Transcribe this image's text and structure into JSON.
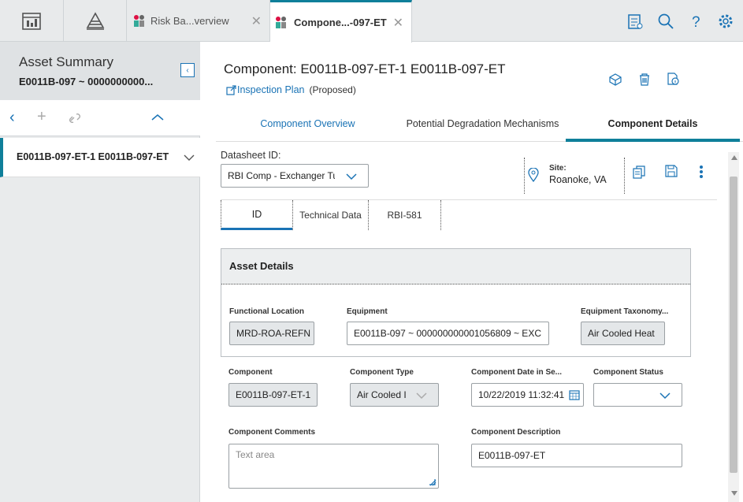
{
  "tabs": [
    {
      "label": "Risk Ba...verview"
    },
    {
      "label": "Compone...-097-ET"
    }
  ],
  "left": {
    "title": "Asset Summary",
    "subtitle": "E0011B-097 ~ 0000000000...",
    "selected_item": "E0011B-097-ET-1 E0011B-097-ET"
  },
  "header": {
    "title": "Component: E0011B-097-ET-1 E0011B-097-ET",
    "link": "Inspection Plan",
    "status": "(Proposed)"
  },
  "main_tabs": [
    "Component Overview",
    "Potential Degradation Mechanisms",
    "Component Details"
  ],
  "datasheet": {
    "label": "Datasheet ID:",
    "value": "RBI Comp - Exchanger Tu",
    "site_label": "Site:",
    "site_value": "Roanoke, VA"
  },
  "sub_tabs": [
    "ID",
    "Technical Data",
    "RBI-581"
  ],
  "asset_details": {
    "title": "Asset Details",
    "functional_location_label": "Functional Location",
    "functional_location_value": "MRD-ROA-REFN",
    "equipment_label": "Equipment",
    "equipment_value": "E0011B-097 ~ 000000000001056809 ~ EXC",
    "taxonomy_label": "Equipment Taxonomy...",
    "taxonomy_value": "Air Cooled Heat"
  },
  "fields": {
    "component_label": "Component",
    "component_value": "E0011B-097-ET-1",
    "type_label": "Component Type",
    "type_value": "Air Cooled I",
    "date_label": "Component Date in Se...",
    "date_value": "10/22/2019 11:32:41",
    "status_label": "Component Status",
    "status_value": "",
    "comments_label": "Component Comments",
    "comments_placeholder": "Text area",
    "description_label": "Component Description",
    "description_value": "E0011B-097-ET"
  },
  "colors": {
    "accent": "#0f7f9a",
    "link": "#1a73b5"
  }
}
